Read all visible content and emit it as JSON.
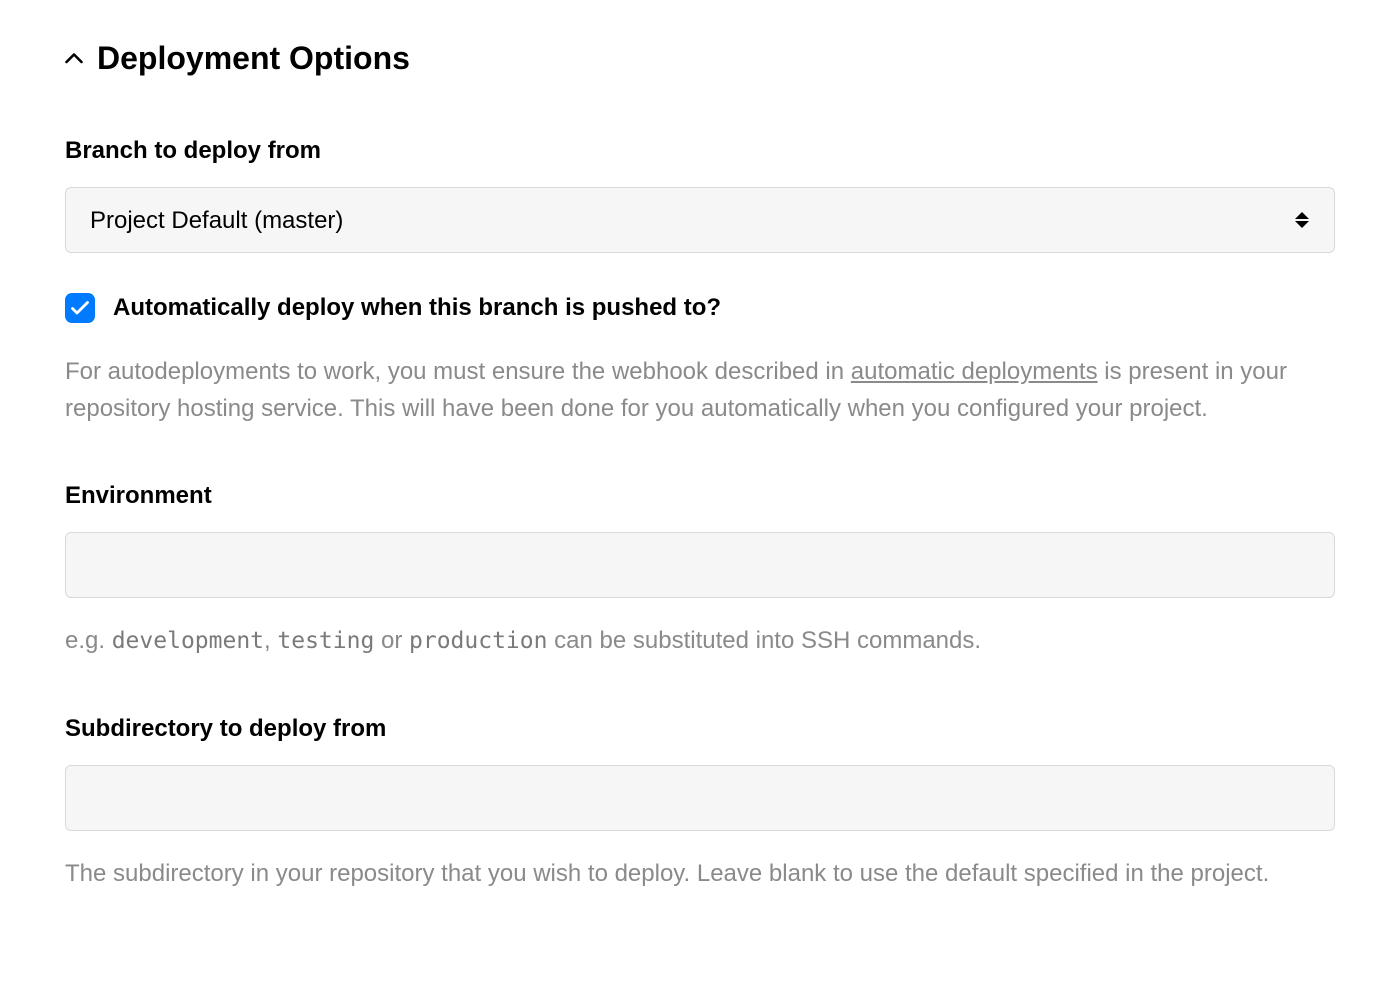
{
  "section": {
    "title": "Deployment Options"
  },
  "branch": {
    "label": "Branch to deploy from",
    "selected": "Project Default (master)"
  },
  "autodeploy": {
    "checked": true,
    "label": "Automatically deploy when this branch is pushed to?",
    "help_before_link": "For autodeployments to work, you must ensure the webhook described in ",
    "help_link_text": "automatic deployments",
    "help_after_link": " is present in your repository hosting service. This will have been done for you automatically when you configured your project."
  },
  "environment": {
    "label": "Environment",
    "value": "",
    "hint_prefix": "e.g. ",
    "hint_code1": "development",
    "hint_sep1": ", ",
    "hint_code2": "testing",
    "hint_sep2": " or ",
    "hint_code3": "production",
    "hint_suffix": " can be substituted into SSH commands."
  },
  "subdirectory": {
    "label": "Subdirectory to deploy from",
    "value": "",
    "hint": "The subdirectory in your repository that you wish to deploy. Leave blank to use the default specified in the project."
  }
}
